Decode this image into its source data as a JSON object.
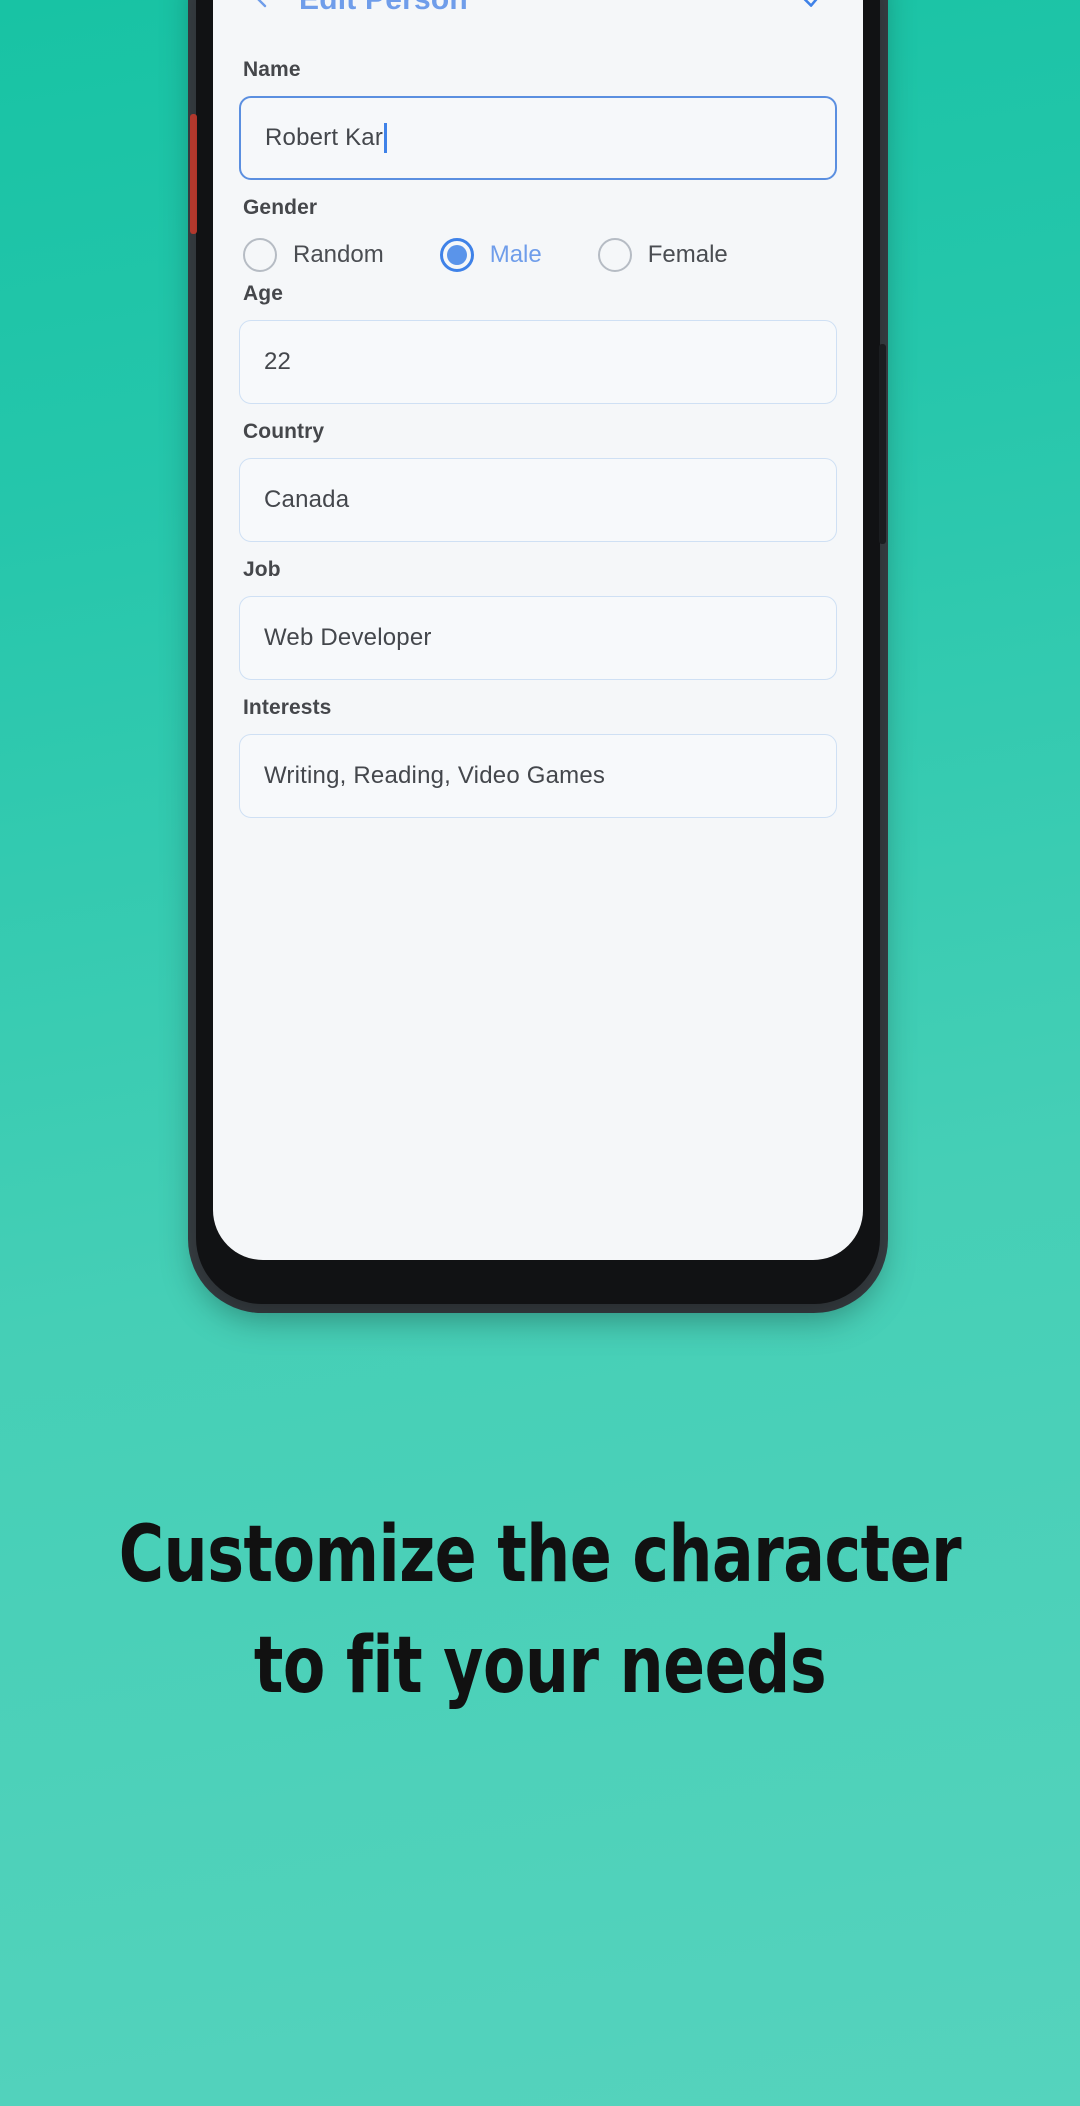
{
  "app_bar": {
    "back_icon": "chevron-left-icon",
    "title": "Edit Person",
    "confirm_icon": "check-icon",
    "title_color": "#6f9dea",
    "accent_color": "#3f82e8"
  },
  "form": {
    "fields": [
      {
        "label": "Name",
        "value": "Robert Kar",
        "focused": true
      },
      {
        "label": "Age",
        "value": "22",
        "focused": false
      },
      {
        "label": "Country",
        "value": "Canada",
        "focused": false
      },
      {
        "label": "Job",
        "value": "Web Developer",
        "focused": false
      },
      {
        "label": "Interests",
        "value": "Writing, Reading, Video Games",
        "focused": false
      }
    ],
    "gender": {
      "label": "Gender",
      "options": [
        {
          "label": "Random",
          "selected": false
        },
        {
          "label": "Male",
          "selected": true
        },
        {
          "label": "Female",
          "selected": false
        }
      ]
    }
  },
  "caption": {
    "line1": "Customize the character",
    "line2": "to fit your needs"
  },
  "theme": {
    "background_top": "#18c3a4",
    "background_bottom": "#55d3bd",
    "screen_bg": "#f5f7f9",
    "field_border": "#cfe0f4",
    "field_border_focus": "#5b8fe0",
    "label_color": "#45474b",
    "value_color": "#44474c"
  }
}
